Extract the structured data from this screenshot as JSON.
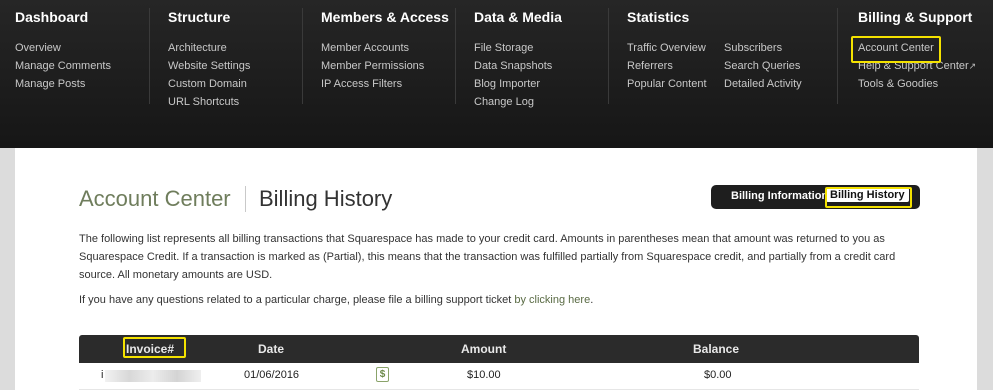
{
  "nav": {
    "columns": [
      {
        "title": "Dashboard",
        "items": [
          "Overview",
          "Manage Comments",
          "Manage Posts"
        ]
      },
      {
        "title": "Structure",
        "items": [
          "Architecture",
          "Website Settings",
          "Custom Domain",
          "URL Shortcuts"
        ]
      },
      {
        "title": "Members & Access",
        "items": [
          "Member Accounts",
          "Member Permissions",
          "IP Access Filters"
        ]
      },
      {
        "title": "Data & Media",
        "items": [
          "File Storage",
          "Data Snapshots",
          "Blog Importer",
          "Change Log"
        ]
      },
      {
        "title": "Statistics",
        "items": [
          "Traffic Overview",
          "Referrers",
          "Popular Content"
        ],
        "items2": [
          "Subscribers",
          "Search Queries",
          "Detailed Activity"
        ]
      },
      {
        "title": "Billing & Support",
        "items": [
          "Account Center",
          "Help & Support Center",
          "Tools & Goodies"
        ]
      }
    ],
    "external_icon": "external-link-icon"
  },
  "page": {
    "section": "Account Center",
    "title": "Billing History",
    "toggle": {
      "billing_information": "Billing Information",
      "billing_history": "Billing History"
    },
    "description": "The following list represents all billing transactions that Squarespace has made to your credit card. Amounts in parentheses mean that amount was returned to you as Squarespace Credit. If a transaction is marked as (Partial), this means that the transaction was fulfilled partially from Squarespace credit, and partially from a credit card source. All monetary amounts are USD.",
    "support_text": "If you have any questions related to a particular charge, please file a billing support ticket ",
    "support_link": "by clicking here",
    "support_end": "."
  },
  "table": {
    "headers": {
      "invoice": "Invoice#",
      "date": "Date",
      "amount": "Amount",
      "balance": "Balance"
    },
    "rows": [
      {
        "invoice_prefix": "i",
        "date": "01/06/2016",
        "receipt_icon": "dollar-receipt-icon",
        "amount": "$10.00",
        "balance": "$0.00"
      }
    ]
  },
  "colors": {
    "nav_bg": "#1e1e1e",
    "highlight": "#f4e200",
    "accent_green": "#6f7d5c"
  }
}
